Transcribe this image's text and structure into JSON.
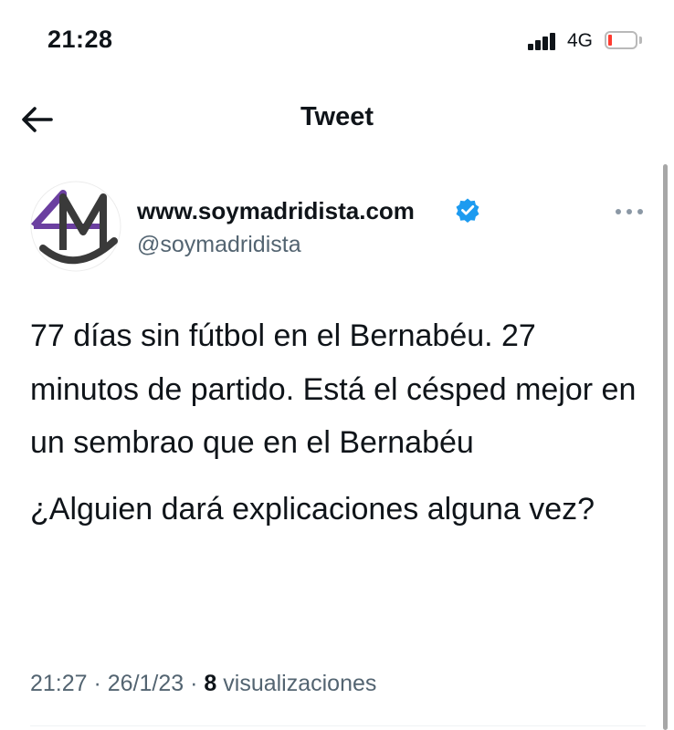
{
  "status_bar": {
    "time": "21:28",
    "network": "4G",
    "icons": [
      "signal-icon",
      "battery-low-icon"
    ],
    "battery_color": "#ff3b30"
  },
  "nav": {
    "title": "Tweet",
    "back_icon": "arrow-left-icon"
  },
  "tweet": {
    "author": {
      "display_name": "www.soymadridista.com",
      "handle": "@soymadridista",
      "verified": true,
      "verified_color": "#1d9bf0",
      "avatar_colors": [
        "#6b3fa0",
        "#3a3a3a"
      ]
    },
    "text_paragraphs": [
      "77 días sin fútbol en el Bernabéu. 27 minutos de partido. Está el césped mejor en un sembrao que en el Bernabéu",
      "¿Alguien dará explicaciones alguna vez?"
    ],
    "timestamp": "21:27 · 26/1/23 · ",
    "views_count": "8",
    "views_label": " visualizaciones"
  },
  "colors": {
    "text_primary": "#0f1419",
    "text_secondary": "#536471"
  }
}
